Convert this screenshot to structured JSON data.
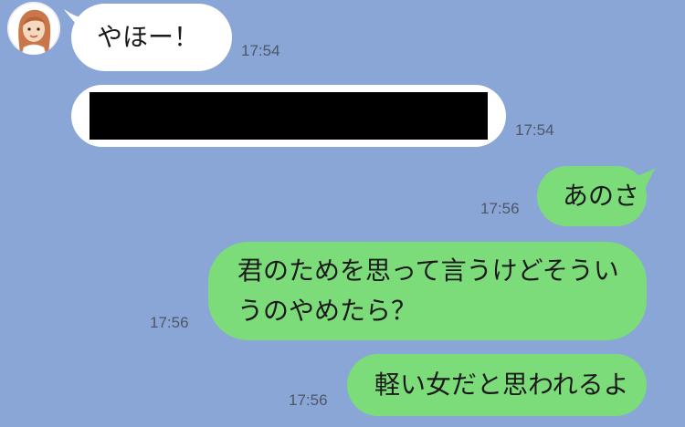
{
  "chat": {
    "messages": [
      {
        "side": "in",
        "text": "やほー！",
        "time": "17:54"
      },
      {
        "side": "in",
        "text": "",
        "redacted": true,
        "time": "17:54"
      },
      {
        "side": "out",
        "text": "あのさ",
        "time": "17:56"
      },
      {
        "side": "out",
        "text": "君のためを思って言うけどそういうのやめたら？",
        "time": "17:56"
      },
      {
        "side": "out",
        "text": "軽い女だと思われるよ",
        "time": "17:56"
      }
    ]
  },
  "colors": {
    "background": "#8aa6d6",
    "incoming_bubble": "#ffffff",
    "outgoing_bubble": "#7ddc7a",
    "redaction": "#000000"
  },
  "icons": {
    "avatar": "woman-avatar-icon"
  }
}
